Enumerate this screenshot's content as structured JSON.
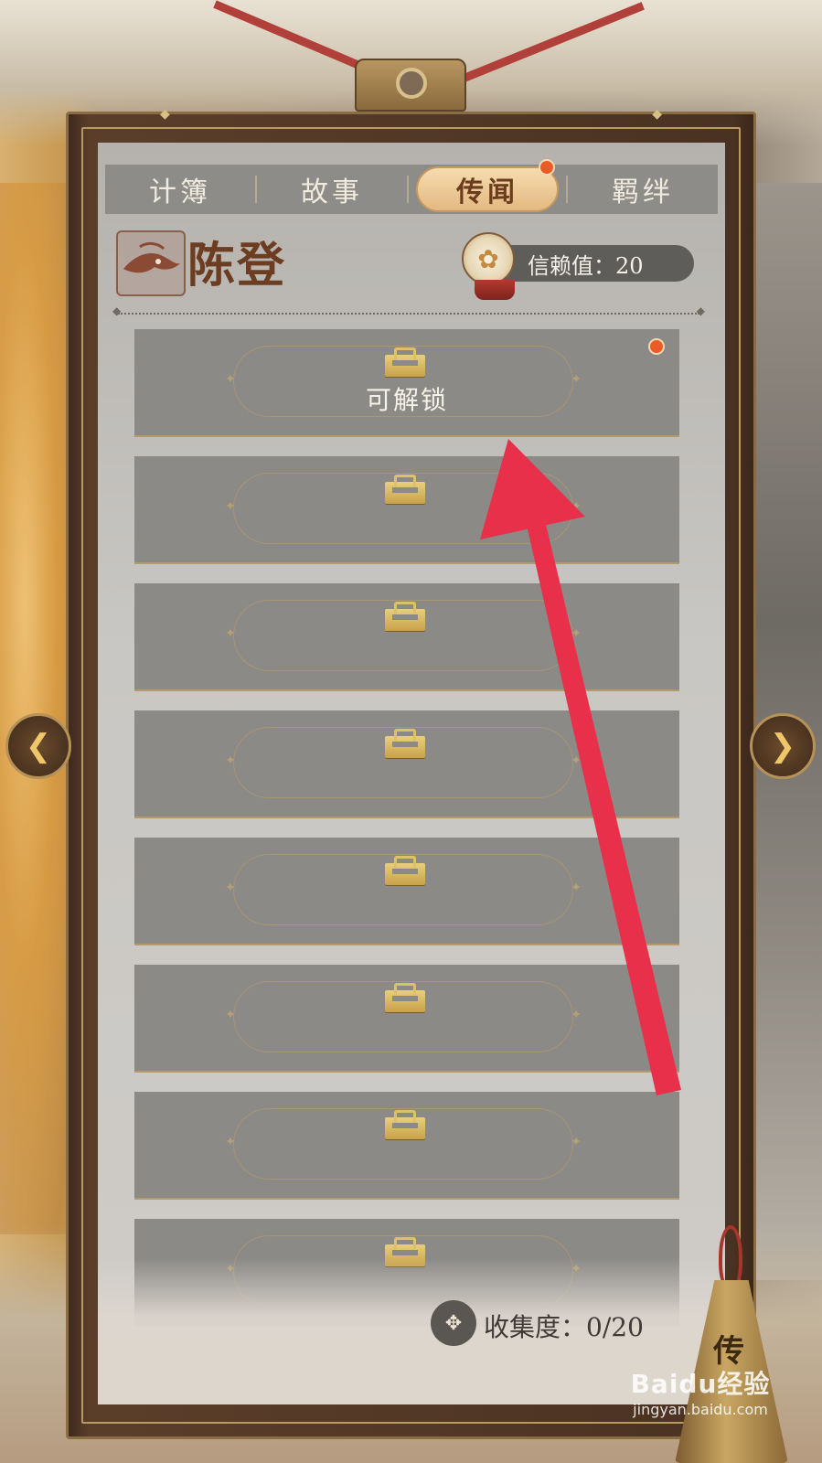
{
  "tabs": [
    {
      "label": "计簿",
      "active": false
    },
    {
      "label": "故事",
      "active": false
    },
    {
      "label": "传闻",
      "active": true,
      "notification": true
    },
    {
      "label": "羁绊",
      "active": false
    }
  ],
  "character": {
    "name": "陈登",
    "trust_label": "信赖值：20"
  },
  "entries": [
    {
      "label": "可解锁",
      "icon": "lock-icon",
      "notification": true
    },
    {
      "label": "",
      "icon": "lock-icon"
    },
    {
      "label": "",
      "icon": "lock-icon"
    },
    {
      "label": "",
      "icon": "lock-icon"
    },
    {
      "label": "",
      "icon": "lock-icon"
    },
    {
      "label": "",
      "icon": "lock-icon"
    },
    {
      "label": "",
      "icon": "lock-icon"
    },
    {
      "label": "",
      "icon": "lock-icon"
    }
  ],
  "collection": {
    "label": "收集度：0/20"
  },
  "bell": {
    "char": "传"
  },
  "watermark": {
    "brand": "Baidu经验",
    "url": "jingyan.baidu.com"
  },
  "colors": {
    "accent": "#e8304a",
    "notification": "#ea5b28",
    "active_tab": "#e9c493",
    "name_text": "#6d3d22"
  }
}
